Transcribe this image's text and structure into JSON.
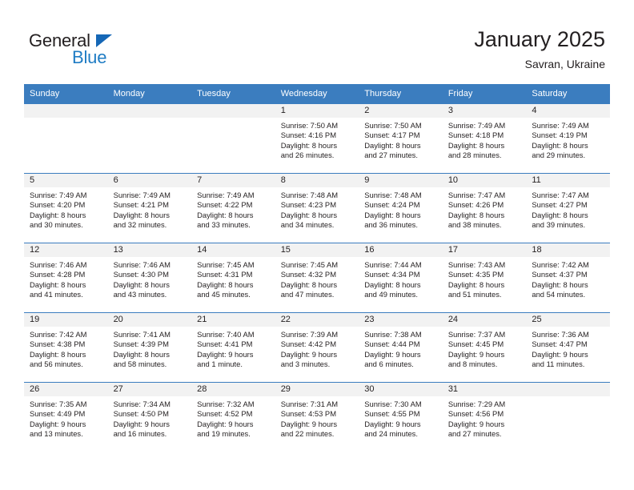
{
  "brand": {
    "name_top": "General",
    "name_bottom": "Blue",
    "triangle_color": "#1567b6",
    "blue_color": "#1f7cc4"
  },
  "header": {
    "title": "January 2025",
    "location": "Savran, Ukraine"
  },
  "theme": {
    "header_blue": "#3b7dbf",
    "daynum_band": "#f2f2f2",
    "text": "#231f20"
  },
  "weekdays": [
    "Sunday",
    "Monday",
    "Tuesday",
    "Wednesday",
    "Thursday",
    "Friday",
    "Saturday"
  ],
  "weeks": [
    [
      {
        "day": "",
        "empty": true
      },
      {
        "day": "",
        "empty": true
      },
      {
        "day": "",
        "empty": true
      },
      {
        "day": "1",
        "sunrise": "Sunrise: 7:50 AM",
        "sunset": "Sunset: 4:16 PM",
        "daylight1": "Daylight: 8 hours",
        "daylight2": "and 26 minutes."
      },
      {
        "day": "2",
        "sunrise": "Sunrise: 7:50 AM",
        "sunset": "Sunset: 4:17 PM",
        "daylight1": "Daylight: 8 hours",
        "daylight2": "and 27 minutes."
      },
      {
        "day": "3",
        "sunrise": "Sunrise: 7:49 AM",
        "sunset": "Sunset: 4:18 PM",
        "daylight1": "Daylight: 8 hours",
        "daylight2": "and 28 minutes."
      },
      {
        "day": "4",
        "sunrise": "Sunrise: 7:49 AM",
        "sunset": "Sunset: 4:19 PM",
        "daylight1": "Daylight: 8 hours",
        "daylight2": "and 29 minutes."
      }
    ],
    [
      {
        "day": "5",
        "sunrise": "Sunrise: 7:49 AM",
        "sunset": "Sunset: 4:20 PM",
        "daylight1": "Daylight: 8 hours",
        "daylight2": "and 30 minutes."
      },
      {
        "day": "6",
        "sunrise": "Sunrise: 7:49 AM",
        "sunset": "Sunset: 4:21 PM",
        "daylight1": "Daylight: 8 hours",
        "daylight2": "and 32 minutes."
      },
      {
        "day": "7",
        "sunrise": "Sunrise: 7:49 AM",
        "sunset": "Sunset: 4:22 PM",
        "daylight1": "Daylight: 8 hours",
        "daylight2": "and 33 minutes."
      },
      {
        "day": "8",
        "sunrise": "Sunrise: 7:48 AM",
        "sunset": "Sunset: 4:23 PM",
        "daylight1": "Daylight: 8 hours",
        "daylight2": "and 34 minutes."
      },
      {
        "day": "9",
        "sunrise": "Sunrise: 7:48 AM",
        "sunset": "Sunset: 4:24 PM",
        "daylight1": "Daylight: 8 hours",
        "daylight2": "and 36 minutes."
      },
      {
        "day": "10",
        "sunrise": "Sunrise: 7:47 AM",
        "sunset": "Sunset: 4:26 PM",
        "daylight1": "Daylight: 8 hours",
        "daylight2": "and 38 minutes."
      },
      {
        "day": "11",
        "sunrise": "Sunrise: 7:47 AM",
        "sunset": "Sunset: 4:27 PM",
        "daylight1": "Daylight: 8 hours",
        "daylight2": "and 39 minutes."
      }
    ],
    [
      {
        "day": "12",
        "sunrise": "Sunrise: 7:46 AM",
        "sunset": "Sunset: 4:28 PM",
        "daylight1": "Daylight: 8 hours",
        "daylight2": "and 41 minutes."
      },
      {
        "day": "13",
        "sunrise": "Sunrise: 7:46 AM",
        "sunset": "Sunset: 4:30 PM",
        "daylight1": "Daylight: 8 hours",
        "daylight2": "and 43 minutes."
      },
      {
        "day": "14",
        "sunrise": "Sunrise: 7:45 AM",
        "sunset": "Sunset: 4:31 PM",
        "daylight1": "Daylight: 8 hours",
        "daylight2": "and 45 minutes."
      },
      {
        "day": "15",
        "sunrise": "Sunrise: 7:45 AM",
        "sunset": "Sunset: 4:32 PM",
        "daylight1": "Daylight: 8 hours",
        "daylight2": "and 47 minutes."
      },
      {
        "day": "16",
        "sunrise": "Sunrise: 7:44 AM",
        "sunset": "Sunset: 4:34 PM",
        "daylight1": "Daylight: 8 hours",
        "daylight2": "and 49 minutes."
      },
      {
        "day": "17",
        "sunrise": "Sunrise: 7:43 AM",
        "sunset": "Sunset: 4:35 PM",
        "daylight1": "Daylight: 8 hours",
        "daylight2": "and 51 minutes."
      },
      {
        "day": "18",
        "sunrise": "Sunrise: 7:42 AM",
        "sunset": "Sunset: 4:37 PM",
        "daylight1": "Daylight: 8 hours",
        "daylight2": "and 54 minutes."
      }
    ],
    [
      {
        "day": "19",
        "sunrise": "Sunrise: 7:42 AM",
        "sunset": "Sunset: 4:38 PM",
        "daylight1": "Daylight: 8 hours",
        "daylight2": "and 56 minutes."
      },
      {
        "day": "20",
        "sunrise": "Sunrise: 7:41 AM",
        "sunset": "Sunset: 4:39 PM",
        "daylight1": "Daylight: 8 hours",
        "daylight2": "and 58 minutes."
      },
      {
        "day": "21",
        "sunrise": "Sunrise: 7:40 AM",
        "sunset": "Sunset: 4:41 PM",
        "daylight1": "Daylight: 9 hours",
        "daylight2": "and 1 minute."
      },
      {
        "day": "22",
        "sunrise": "Sunrise: 7:39 AM",
        "sunset": "Sunset: 4:42 PM",
        "daylight1": "Daylight: 9 hours",
        "daylight2": "and 3 minutes."
      },
      {
        "day": "23",
        "sunrise": "Sunrise: 7:38 AM",
        "sunset": "Sunset: 4:44 PM",
        "daylight1": "Daylight: 9 hours",
        "daylight2": "and 6 minutes."
      },
      {
        "day": "24",
        "sunrise": "Sunrise: 7:37 AM",
        "sunset": "Sunset: 4:45 PM",
        "daylight1": "Daylight: 9 hours",
        "daylight2": "and 8 minutes."
      },
      {
        "day": "25",
        "sunrise": "Sunrise: 7:36 AM",
        "sunset": "Sunset: 4:47 PM",
        "daylight1": "Daylight: 9 hours",
        "daylight2": "and 11 minutes."
      }
    ],
    [
      {
        "day": "26",
        "sunrise": "Sunrise: 7:35 AM",
        "sunset": "Sunset: 4:49 PM",
        "daylight1": "Daylight: 9 hours",
        "daylight2": "and 13 minutes."
      },
      {
        "day": "27",
        "sunrise": "Sunrise: 7:34 AM",
        "sunset": "Sunset: 4:50 PM",
        "daylight1": "Daylight: 9 hours",
        "daylight2": "and 16 minutes."
      },
      {
        "day": "28",
        "sunrise": "Sunrise: 7:32 AM",
        "sunset": "Sunset: 4:52 PM",
        "daylight1": "Daylight: 9 hours",
        "daylight2": "and 19 minutes."
      },
      {
        "day": "29",
        "sunrise": "Sunrise: 7:31 AM",
        "sunset": "Sunset: 4:53 PM",
        "daylight1": "Daylight: 9 hours",
        "daylight2": "and 22 minutes."
      },
      {
        "day": "30",
        "sunrise": "Sunrise: 7:30 AM",
        "sunset": "Sunset: 4:55 PM",
        "daylight1": "Daylight: 9 hours",
        "daylight2": "and 24 minutes."
      },
      {
        "day": "31",
        "sunrise": "Sunrise: 7:29 AM",
        "sunset": "Sunset: 4:56 PM",
        "daylight1": "Daylight: 9 hours",
        "daylight2": "and 27 minutes."
      },
      {
        "day": "",
        "empty": true
      }
    ]
  ]
}
